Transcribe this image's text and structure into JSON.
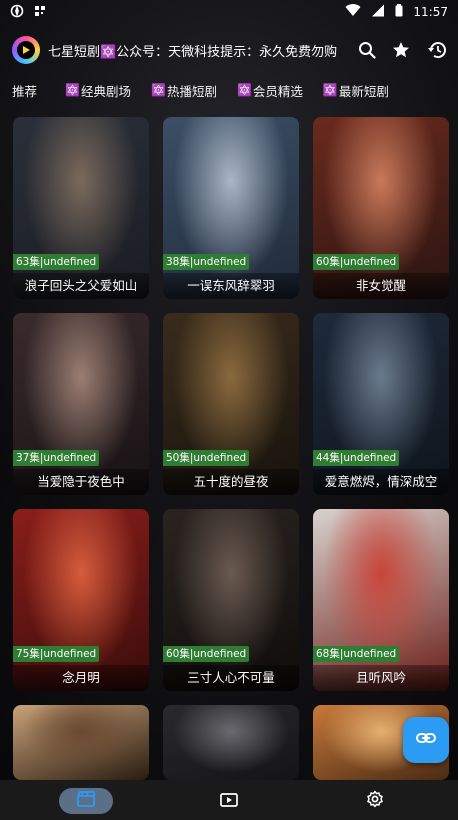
{
  "status_bar": {
    "time": "11:57"
  },
  "header": {
    "marquee_text": "七星短剧🔯公众号：天微科技提示：永久免费勿购买"
  },
  "tabs": [
    {
      "label": "推荐",
      "icon": ""
    },
    {
      "label": "经典剧场",
      "icon": "🔯"
    },
    {
      "label": "热播短剧",
      "icon": "🔯"
    },
    {
      "label": "会员精选",
      "icon": "🔯"
    },
    {
      "label": "最新短剧",
      "icon": "🔯"
    }
  ],
  "cards": [
    {
      "badge": "63集|undefined",
      "title": "浪子回头之父爱如山",
      "colors": [
        "#2a2f3a",
        "#7a6a5c",
        "#1b1c22"
      ]
    },
    {
      "badge": "38集|undefined",
      "title": "一误东风辞翠羽",
      "colors": [
        "#3c4f66",
        "#a9b6c6",
        "#1f2a3a"
      ]
    },
    {
      "badge": "60集|undefined",
      "title": "非女觉醒",
      "colors": [
        "#6a2a1e",
        "#c9795a",
        "#2a1410"
      ]
    },
    {
      "badge": "37集|undefined",
      "title": "当爱隐于夜色中",
      "colors": [
        "#3a2a2c",
        "#9a7e72",
        "#161214"
      ]
    },
    {
      "badge": "50集|undefined",
      "title": "五十度的昼夜",
      "colors": [
        "#3a2c1c",
        "#8a6a3e",
        "#16120c"
      ]
    },
    {
      "badge": "44集|undefined",
      "title": "爱意燃烬，情深成空",
      "colors": [
        "#1e2a3a",
        "#6a7a8e",
        "#0e141c"
      ]
    },
    {
      "badge": "75集|undefined",
      "title": "念月明",
      "colors": [
        "#8a1e1a",
        "#d65c3c",
        "#3a0c0a"
      ]
    },
    {
      "badge": "60集|undefined",
      "title": "三寸人心不可量",
      "colors": [
        "#2a2420",
        "#6a5a50",
        "#0e0c0a"
      ]
    },
    {
      "badge": "68集|undefined",
      "title": "且听风吟",
      "colors": [
        "#d8d2ce",
        "#c9453a",
        "#6a1c16"
      ]
    },
    {
      "badge": "",
      "title": "",
      "colors": [
        "#c9a27a",
        "#6a4a30",
        "#2a1c10"
      ]
    },
    {
      "badge": "",
      "title": "",
      "colors": [
        "#2a2a2e",
        "#6a6a70",
        "#141416"
      ]
    },
    {
      "badge": "",
      "title": "",
      "colors": [
        "#c97a3a",
        "#e6b070",
        "#4a2a14"
      ]
    }
  ],
  "bottom_nav": [
    {
      "name": "drama-tab",
      "icon": "clapperboard-icon"
    },
    {
      "name": "play-tab",
      "icon": "play-icon"
    },
    {
      "name": "settings-tab",
      "icon": "gear-icon"
    }
  ]
}
